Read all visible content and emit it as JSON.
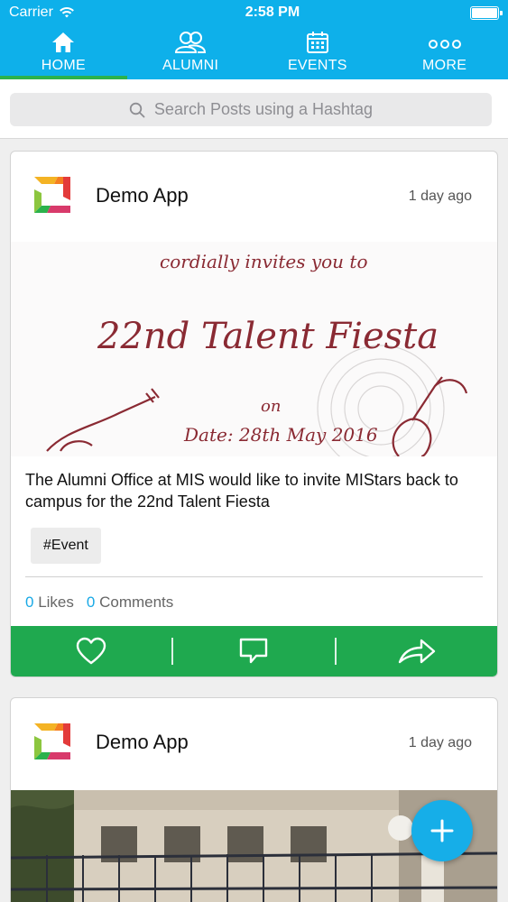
{
  "status_bar": {
    "carrier": "Carrier",
    "time": "2:58 PM",
    "battery_level": 1.0
  },
  "tabs": [
    {
      "label": "HOME",
      "icon": "home-icon",
      "active": true
    },
    {
      "label": "ALUMNI",
      "icon": "people-icon",
      "active": false
    },
    {
      "label": "EVENTS",
      "icon": "calendar-icon",
      "active": false
    },
    {
      "label": "MORE",
      "icon": "more-dots-icon",
      "active": false
    }
  ],
  "search": {
    "placeholder": "Search Posts using a Hashtag"
  },
  "posts": [
    {
      "author": "Demo App",
      "time_ago": "1 day ago",
      "poster": {
        "line1": "cordially invites you to",
        "line2": "22nd Talent Fiesta",
        "line3": "on",
        "line4": "Date: 28th May 2016"
      },
      "caption": "The Alumni Office at MIS would like to invite MIStars back to campus for the 22nd Talent Fiesta",
      "hashtag": "#Event",
      "likes_count": "0",
      "likes_label": "Likes",
      "comments_count": "0",
      "comments_label": "Comments"
    },
    {
      "author": "Demo App",
      "time_ago": "1 day ago"
    }
  ],
  "colors": {
    "header": "#0eb0ea",
    "action_bar": "#1fa94f",
    "accent": "#19a9e6",
    "fab": "#16aee8"
  }
}
